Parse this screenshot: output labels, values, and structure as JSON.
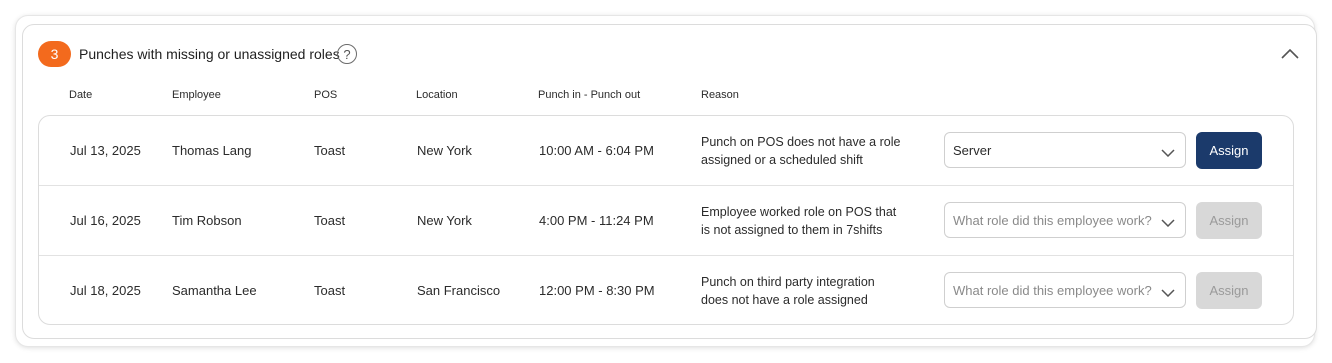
{
  "header": {
    "count": "3",
    "title": "Punches with missing or unassigned roles",
    "help": "?"
  },
  "columns": {
    "date": "Date",
    "employee": "Employee",
    "pos": "POS",
    "location": "Location",
    "punch": "Punch in - Punch out",
    "reason": "Reason"
  },
  "rows": [
    {
      "date": "Jul 13, 2025",
      "employee": "Thomas Lang",
      "pos": "Toast",
      "location": "New York",
      "punch": "10:00 AM - 6:04 PM",
      "reason_line1": "Punch on POS does not have a role",
      "reason_line2": "assigned or a scheduled shift",
      "role_value": "Server",
      "assign_label": "Assign"
    },
    {
      "date": "Jul 16, 2025",
      "employee": "Tim Robson",
      "pos": "Toast",
      "location": "New York",
      "punch": "4:00 PM - 11:24 PM",
      "reason_line1": "Employee worked role on POS that",
      "reason_line2": "is not assigned to them in 7shifts",
      "role_placeholder": "What role did this employee work?",
      "assign_label": "Assign"
    },
    {
      "date": "Jul 18, 2025",
      "employee": "Samantha Lee",
      "pos": "Toast",
      "location": "San Francisco",
      "punch": "12:00 PM - 8:30 PM",
      "reason_line1": "Punch on third party integration",
      "reason_line2": "does not have a role assigned",
      "role_placeholder": "What role did this employee work?",
      "assign_label": "Assign"
    }
  ],
  "icons": {
    "help": "question-circle-icon",
    "collapse": "chevron-up-icon",
    "select": "chevron-down-icon"
  },
  "colors": {
    "badge": "#f36a1d",
    "primary_button": "#1b3a6b",
    "disabled_button": "#d8d8d8"
  }
}
